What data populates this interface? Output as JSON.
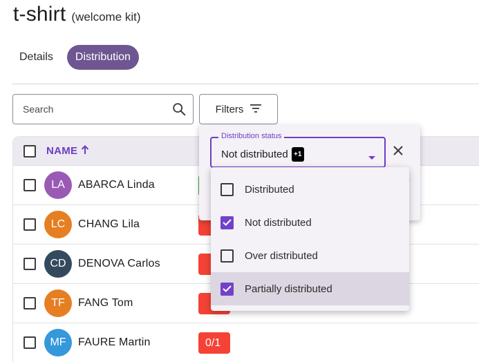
{
  "header": {
    "title": "t-shirt",
    "subtitle": "(welcome kit)"
  },
  "tabs": [
    {
      "label": "Details",
      "active": false
    },
    {
      "label": "Distribution",
      "active": true
    }
  ],
  "search": {
    "placeholder": "Search",
    "icon": "search-icon"
  },
  "filters": {
    "label": "Filters",
    "icon": "filter-icon"
  },
  "table": {
    "columns": [
      {
        "label": "NAME",
        "sort": "ascending"
      }
    ],
    "rows": [
      {
        "initials": "LA",
        "name": "ABARCA Linda",
        "avatar_color": "#9b59b6",
        "chip_color": "#43a047",
        "chip": ""
      },
      {
        "initials": "LC",
        "name": "CHANG Lila",
        "avatar_color": "#e67e22",
        "chip_color": "#f44336",
        "chip": ""
      },
      {
        "initials": "CD",
        "name": "DENOVA Carlos",
        "avatar_color": "#34495e",
        "chip_color": "#f44336",
        "chip": ""
      },
      {
        "initials": "TF",
        "name": "FANG Tom",
        "avatar_color": "#e67e22",
        "chip_color": "#f44336",
        "chip": ""
      },
      {
        "initials": "MF",
        "name": "FAURE Martin",
        "avatar_color": "#3498db",
        "chip_color": "#f44336",
        "chip": "0/1"
      }
    ]
  },
  "filter_panel": {
    "field_label": "Distribution status",
    "selected_value": "Not distributed",
    "extra_count": "+1"
  },
  "status_options": [
    {
      "label": "Distributed",
      "checked": false,
      "highlighted": false
    },
    {
      "label": "Not distributed",
      "checked": true,
      "highlighted": false
    },
    {
      "label": "Over distributed",
      "checked": false,
      "highlighted": false
    },
    {
      "label": "Partially distributed",
      "checked": true,
      "highlighted": true
    }
  ],
  "colors": {
    "accent": "#6d3cc4",
    "tab_active": "#6d5691",
    "checkbox_checked": "#7341c9"
  }
}
